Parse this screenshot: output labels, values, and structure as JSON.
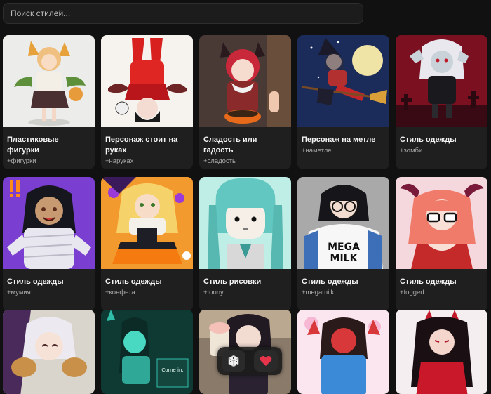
{
  "search": {
    "placeholder": "Поиск стилей..."
  },
  "cards": [
    {
      "title": "Пластиковые фигурки",
      "tag": "+фигурки"
    },
    {
      "title": "Персонаж стоит на руках",
      "tag": "+наруках"
    },
    {
      "title": "Сладость или гадость",
      "tag": "+сладость"
    },
    {
      "title": "Персонаж на метле",
      "tag": "+наметле"
    },
    {
      "title": "Стиль одежды",
      "tag": "+зомби"
    },
    {
      "title": "Стиль одежды",
      "tag": "+мумия"
    },
    {
      "title": "Стиль одежды",
      "tag": "+конфета"
    },
    {
      "title": "Стиль рисовки",
      "tag": "+toony"
    },
    {
      "title": "Стиль одежды",
      "tag": "+megamilk"
    },
    {
      "title": "Стиль одежды",
      "tag": "+fogged"
    }
  ],
  "row3": {
    "caption": "Come in."
  },
  "thumbs": {
    "megamilk_text_1": "MEGA",
    "megamilk_text_2": "MILK"
  },
  "actions": {
    "dice": "dice-icon",
    "heart": "heart-icon"
  },
  "colors": {
    "accent": "#e8344a",
    "background": "#111111",
    "card": "#1f1f1f"
  }
}
